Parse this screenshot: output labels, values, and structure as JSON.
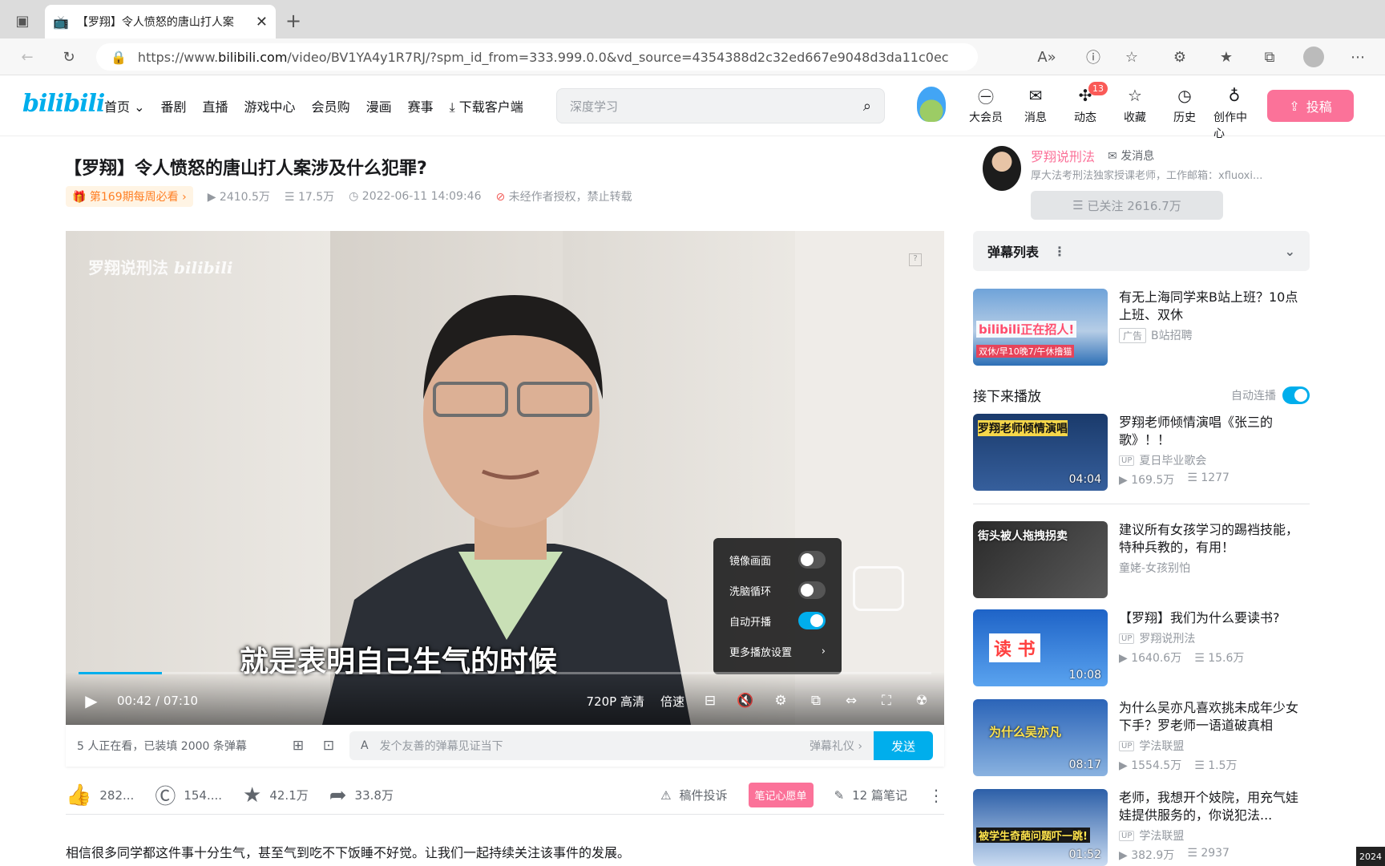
{
  "browser": {
    "tab_title": "【罗翔】令人愤怒的唐山打人案",
    "url_prefix": "https://www.",
    "url_domain": "bilibili.com",
    "url_rest": "/video/BV1YA4y1R7RJ/?spm_id_from=333.999.0.0&vd_source=4354388d2c32ed667e9048d3da11c0ec"
  },
  "header": {
    "logo": "bilibili",
    "nav": [
      "首页",
      "番剧",
      "直播",
      "游戏中心",
      "会员购",
      "漫画",
      "赛事",
      "下载客户端"
    ],
    "search_placeholder": "深度学习",
    "icons": [
      {
        "label": "大会员",
        "icon": "vip-icon"
      },
      {
        "label": "消息",
        "icon": "message-icon"
      },
      {
        "label": "动态",
        "icon": "dynamic-icon",
        "badge": "13"
      },
      {
        "label": "收藏",
        "icon": "star-icon"
      },
      {
        "label": "历史",
        "icon": "history-icon"
      },
      {
        "label": "创作中心",
        "icon": "creator-icon"
      }
    ],
    "upload_label": "投稿"
  },
  "video": {
    "title": "【罗翔】令人愤怒的唐山打人案涉及什么犯罪?",
    "weekly": "第169期每周必看",
    "views": "2410.5万",
    "danmaku_count": "17.5万",
    "date": "2022-06-11 14:09:46",
    "copyright": "未经作者授权，禁止转载",
    "watermark": "罗翔说刑法",
    "watermark_logo": "bilibili",
    "subtitle": "就是表明自己生气的时候",
    "time_current": "00:42",
    "time_total": "07:10",
    "progress": 0.098,
    "quality": "720P 高清",
    "speed": "倍速",
    "settings": [
      {
        "label": "镜像画面",
        "on": false
      },
      {
        "label": "洗脑循环",
        "on": false
      },
      {
        "label": "自动开播",
        "on": true
      }
    ],
    "more_settings": "更多播放设置"
  },
  "danmaku_bar": {
    "info": "5 人正在看，已装填 2000 条弹幕",
    "placeholder": "发个友善的弹幕见证当下",
    "etiquette": "弹幕礼仪",
    "send": "发送"
  },
  "toolbar": {
    "like": "282...",
    "coin": "154....",
    "favorite": "42.1万",
    "share": "33.8万",
    "report": "稿件投诉",
    "note_badge": "笔记心愿单",
    "notes": "12 篇笔记"
  },
  "description": "相信很多同学都这件事十分生气，甚至气到吃不下饭睡不好觉。让我们一起持续关注该事件的发展。",
  "uploader": {
    "name": "罗翔说刑法",
    "message": "发消息",
    "desc": "厚大法考刑法独家授课老师，工作邮箱：xfluoxi...",
    "follow": "已关注 2616.7万"
  },
  "right": {
    "danmaku_list": "弹幕列表",
    "up_next": "接下来播放",
    "autoplay": "自动连播",
    "ad": {
      "title": "有无上海同学来B站上班？10点上班、双休",
      "tag": "广告",
      "source": "B站招聘",
      "thumb_text": "bilibili正在招人!",
      "thumb_sub": "双休/早10晚7/午休撸猫"
    },
    "videos": [
      {
        "title": "罗翔老师倾情演唱《张三的歌》！！",
        "up": "夏日毕业歌会",
        "views": "169.5万",
        "danmaku": "1277",
        "duration": "04:04",
        "thumb_text": "罗翔老师倾情演唱"
      },
      {
        "title": "建议所有女孩学习的踢裆技能，特种兵教的，有用！",
        "up": "童姥-女孩别怕",
        "views": "",
        "danmaku": "",
        "duration": "",
        "thumb_text": "街头被人拖拽拐卖"
      },
      {
        "title": "【罗翔】我们为什么要读书?",
        "up": "罗翔说刑法",
        "views": "1640.6万",
        "danmaku": "15.6万",
        "duration": "10:08",
        "thumb_text": "读 书"
      },
      {
        "title": "为什么吴亦凡喜欢挑未成年少女下手？罗老师一语道破真相",
        "up": "学法联盟",
        "views": "1554.5万",
        "danmaku": "1.5万",
        "duration": "08:17",
        "thumb_text": "为什么吴亦凡"
      },
      {
        "title": "老师，我想开个妓院，用充气娃娃提供服务的，你说犯法...",
        "up": "学法联盟",
        "views": "382.9万",
        "danmaku": "2937",
        "duration": "01:52",
        "thumb_text": "被学生奇葩问题吓一跳!"
      }
    ]
  },
  "corner": "2024"
}
